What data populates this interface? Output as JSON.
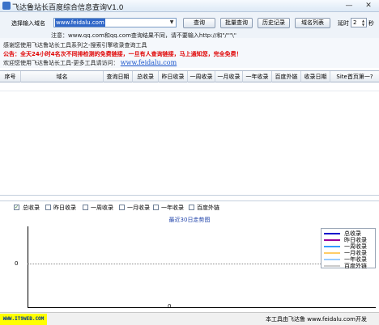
{
  "window": {
    "title": "飞达鲁站长百度综合信息查询V1.0",
    "minimize_icon": "minimize-icon",
    "close_icon": "close-icon"
  },
  "toolbar": {
    "domain_label": "选择输入域名",
    "domain_value": "www.feidalu.com",
    "query_button": "查询",
    "batch_button": "批量查询",
    "history_button": "历史记录",
    "domain_list_button": "域名列表",
    "delay_label": "延时",
    "delay_value": "2",
    "delay_unit": "秒",
    "note": "注意：www.qq.com和qq.com查询结果不同，请不要输入http://和\"/\"\"\\\""
  },
  "info": {
    "line1": "感谢您使用飞达鲁站长工具系列之-搜索引擎收录查询工具",
    "line2": "公告：全天24小时4名次不同排检测的免费链接，一旦有人查询链接，马上通知您，完全免费！",
    "line3_prefix": "欢迎您使用飞达鲁站长工具-更多工具请访问：",
    "line3_link": "www.feidalu.com"
  },
  "grid": {
    "columns": [
      "序号",
      "域名",
      "查询日期",
      "总收录",
      "昨日收录",
      "一周收录",
      "一月收录",
      "一年收录",
      "百度外链",
      "收录日期",
      "Site首页第一?"
    ],
    "rows": []
  },
  "filters": [
    {
      "label": "总收录",
      "checked": true
    },
    {
      "label": "昨日收录",
      "checked": false
    },
    {
      "label": "一周收录",
      "checked": false
    },
    {
      "label": "一月收录",
      "checked": false
    },
    {
      "label": "一年收录",
      "checked": false
    },
    {
      "label": "百度外链",
      "checked": false
    }
  ],
  "chart_data": {
    "type": "line",
    "title": "最近30日走势图",
    "y_ticks": [
      "0"
    ],
    "x_ticks": [
      "0"
    ],
    "series": [
      {
        "name": "总收录",
        "color": "#0000cc",
        "values": []
      },
      {
        "name": "昨日收录",
        "color": "#990099",
        "values": []
      },
      {
        "name": "一周收录",
        "color": "#3399ff",
        "values": []
      },
      {
        "name": "一月收录",
        "color": "#ffcc66",
        "values": []
      },
      {
        "name": "一年收录",
        "color": "#99ccff",
        "values": []
      },
      {
        "name": "百度外链",
        "color": "#cccccc",
        "values": []
      }
    ]
  },
  "status": {
    "logo_text": "WWW.IT9WEB.COM",
    "credit": "本工具由飞达鲁 www.feidalu.com开发"
  }
}
